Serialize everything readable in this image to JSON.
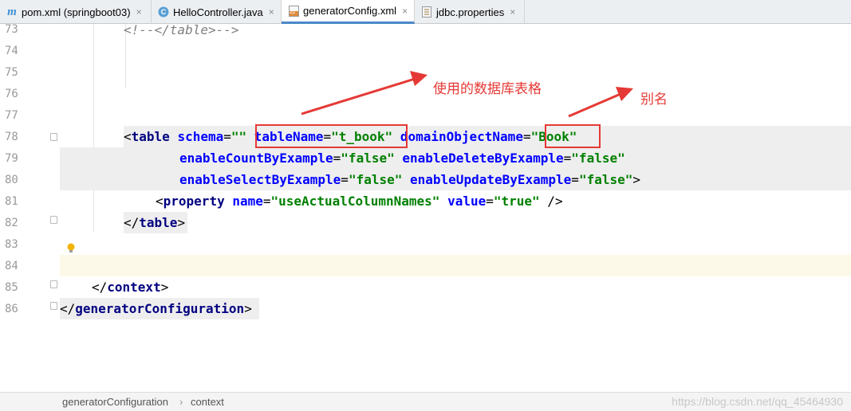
{
  "tabs": [
    {
      "label": "pom.xml (springboot03)",
      "icon": "maven-icon",
      "closable": true,
      "active": false
    },
    {
      "label": "HelloController.java",
      "icon": "class-icon",
      "closable": true,
      "active": false
    },
    {
      "label": "generatorConfig.xml",
      "icon": "xml-file-icon",
      "closable": true,
      "active": true
    },
    {
      "label": "jdbc.properties",
      "icon": "properties-file-icon",
      "closable": true,
      "active": false
    }
  ],
  "close_glyph": "×",
  "icon_text": {
    "maven": "m",
    "class": "C",
    "xml": "<>"
  },
  "line_numbers": [
    "73",
    "74",
    "75",
    "76",
    "77",
    "78",
    "79",
    "80",
    "81",
    "82",
    "83",
    "84",
    "85",
    "86"
  ],
  "code": {
    "l73": {
      "comment": "<!--</table>-->"
    },
    "l78": {
      "open": "<",
      "tag": "table",
      "a1": " schema",
      "eq1": "=",
      "v1": "\"\"",
      "a2": " tableName",
      "eq2": "=",
      "v2": "\"t_book\"",
      "a3": " domainObjectName",
      "eq3": "=",
      "v3": "\"Book\""
    },
    "l79": {
      "a1": "enableCountByExample",
      "eq1": "=",
      "v1": "\"false\"",
      "a2": " enableDeleteByExample",
      "eq2": "=",
      "v2": "\"false\""
    },
    "l80": {
      "a1": "enableSelectByExample",
      "eq1": "=",
      "v1": "\"false\"",
      "a2": " enableUpdateByExample",
      "eq2": "=",
      "v2": "\"false\"",
      "close": ">"
    },
    "l81": {
      "open": "<",
      "tag": "property",
      "a1": " name",
      "eq1": "=",
      "v1": "\"useActualColumnNames\"",
      "a2": " value",
      "eq2": "=",
      "v2": "\"true\"",
      "close": " />"
    },
    "l82": {
      "open": "</",
      "tag": "table",
      "close": ">"
    },
    "l85": {
      "open": "</",
      "tag": "context",
      "close": ">"
    },
    "l86": {
      "open": "</",
      "tag": "generatorConfiguration",
      "close": ">"
    }
  },
  "annotations": {
    "table_label": "使用的数据库表格",
    "alias_label": "别名",
    "color": "#e53935"
  },
  "status_bar": {
    "crumb1": "generatorConfiguration",
    "separator": "›",
    "crumb2": "context",
    "watermark": "https://blog.csdn.net/qq_45464930"
  },
  "colors": {
    "tag": "#000080",
    "attribute": "#0000ff",
    "value": "#008000",
    "line_number": "#999999",
    "active_tab_underline": "#4a88c7",
    "current_line": "#fcf9e8"
  }
}
